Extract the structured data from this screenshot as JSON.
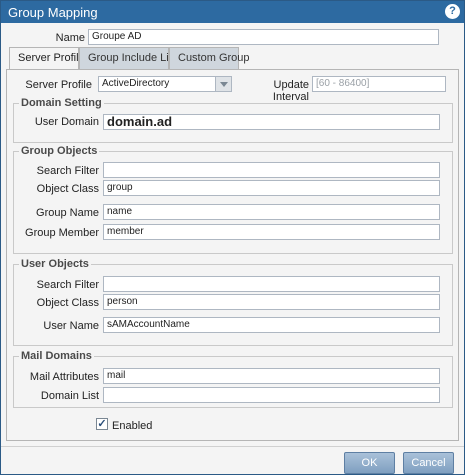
{
  "dialog": {
    "title": "Group Mapping",
    "help_glyph": "?",
    "name_label": "Name",
    "name_value": "Groupe AD"
  },
  "tabs": [
    {
      "label": "Server Profile",
      "active": true
    },
    {
      "label": "Group Include List",
      "active": false
    },
    {
      "label": "Custom Group",
      "active": false
    }
  ],
  "server_profile": {
    "label": "Server Profile",
    "value": "ActiveDirectory",
    "update_interval_label": "Update Interval",
    "update_interval_placeholder": "[60 - 86400]"
  },
  "domain_setting": {
    "title": "Domain Setting",
    "user_domain_label": "User Domain",
    "user_domain_value": "domain.ad"
  },
  "group_objects": {
    "title": "Group Objects",
    "search_filter_label": "Search Filter",
    "search_filter_value": "",
    "object_class_label": "Object Class",
    "object_class_value": "group",
    "group_name_label": "Group Name",
    "group_name_value": "name",
    "group_member_label": "Group Member",
    "group_member_value": "member"
  },
  "user_objects": {
    "title": "User Objects",
    "search_filter_label": "Search Filter",
    "search_filter_value": "",
    "object_class_label": "Object Class",
    "object_class_value": "person",
    "user_name_label": "User Name",
    "user_name_value": "sAMAccountName"
  },
  "mail_domains": {
    "title": "Mail Domains",
    "mail_attributes_label": "Mail Attributes",
    "mail_attributes_value": "mail",
    "domain_list_label": "Domain List",
    "domain_list_value": ""
  },
  "enabled": {
    "label": "Enabled",
    "checked": true,
    "check_glyph": "✓"
  },
  "buttons": {
    "ok": "OK",
    "cancel": "Cancel"
  },
  "colors": {
    "titlebar": "#2d6aa1",
    "button": "#8fadcc"
  }
}
